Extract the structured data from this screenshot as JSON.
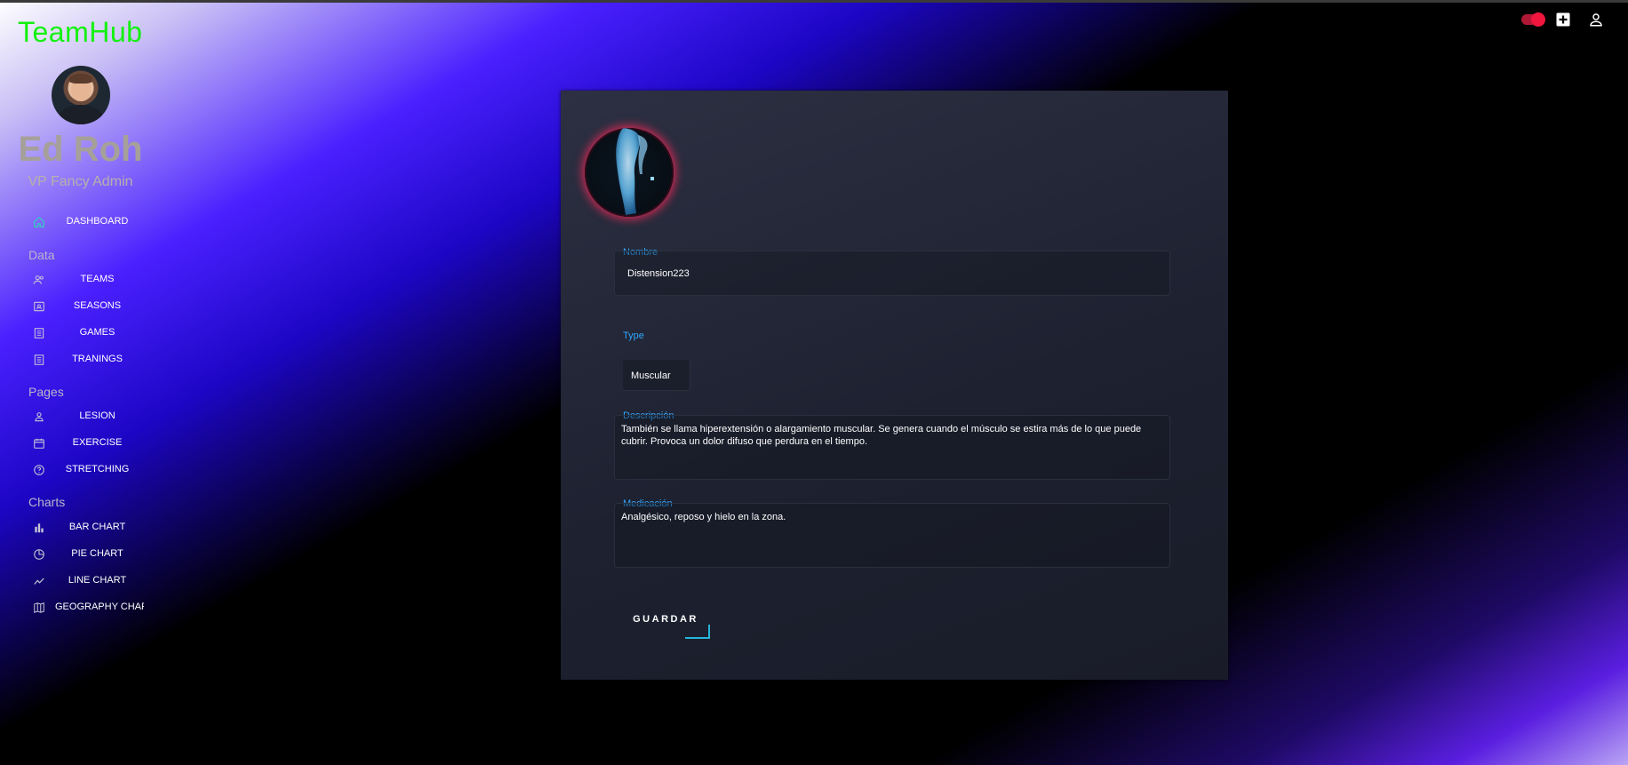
{
  "app": {
    "brand": "TeamHub"
  },
  "user": {
    "name": "Ed Roh",
    "role": "VP Fancy Admin"
  },
  "sidebar": {
    "dashboard": {
      "label": "DASHBOARD",
      "icon": "home-icon"
    },
    "sections": {
      "data": "Data",
      "pages": "Pages",
      "charts": "Charts"
    },
    "data_items": [
      {
        "label": "TEAMS",
        "icon": "people-icon"
      },
      {
        "label": "SEASONS",
        "icon": "contacts-icon"
      },
      {
        "label": "GAMES",
        "icon": "receipt-icon"
      },
      {
        "label": "TRANINGS",
        "icon": "receipt-icon"
      }
    ],
    "page_items": [
      {
        "label": "LESION",
        "icon": "person-icon"
      },
      {
        "label": "EXERCISE",
        "icon": "calendar-icon"
      },
      {
        "label": "STRETCHING",
        "icon": "help-icon"
      }
    ],
    "chart_items": [
      {
        "label": "BAR CHART",
        "icon": "bar-chart-icon"
      },
      {
        "label": "PIE CHART",
        "icon": "pie-chart-icon"
      },
      {
        "label": "LINE CHART",
        "icon": "timeline-icon"
      },
      {
        "label": "GEOGRAPHY CHART",
        "icon": "map-icon"
      }
    ],
    "active_color": "#2fd1c0"
  },
  "topbar": {
    "icons": [
      "theme-toggle",
      "add-box-icon",
      "person-icon"
    ],
    "toggle_color": "#f0163d"
  },
  "form": {
    "image_icon": "xray-leg-image",
    "nombre": {
      "label": "Nombre",
      "value": "Distension223"
    },
    "type": {
      "label": "Type",
      "value": "Muscular"
    },
    "descripcion": {
      "label": "Descripción",
      "value": "También se llama hiperextensión o alargamiento muscular. Se genera cuando el músculo se estira más de lo que puede cubrir. Provoca un dolor difuso que perdura en el tiempo."
    },
    "medicacion": {
      "label": "Medicación",
      "value": "Analgésico, reposo y hielo en la zona."
    },
    "save_label": "GUARDAR",
    "accent_color": "#2fa8ff"
  }
}
